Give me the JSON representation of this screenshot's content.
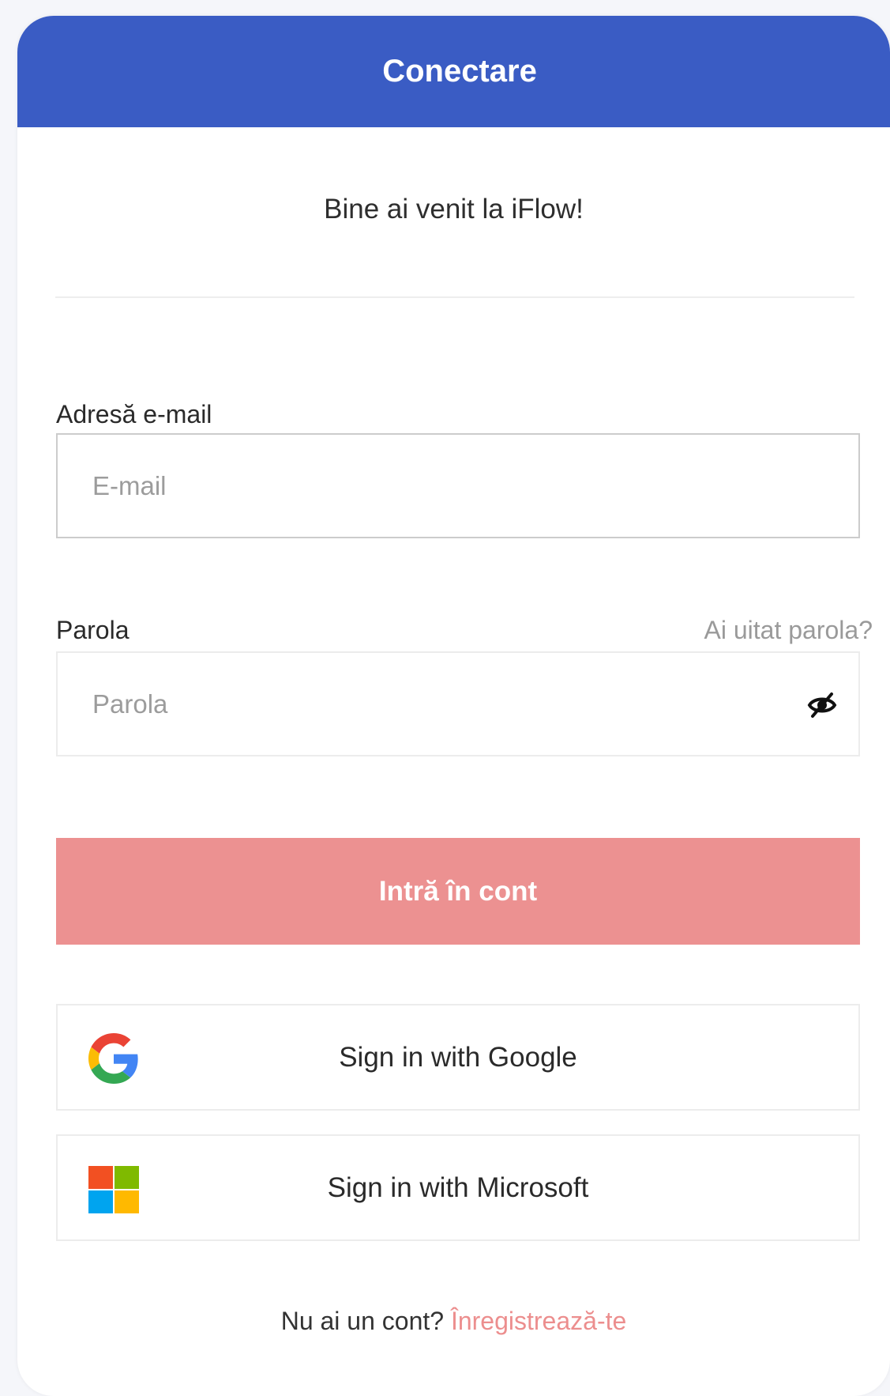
{
  "header": {
    "title": "Conectare"
  },
  "welcome": "Bine ai venit la iFlow!",
  "email": {
    "label": "Adresă e-mail",
    "placeholder": "E-mail",
    "value": ""
  },
  "password": {
    "label": "Parola",
    "placeholder": "Parola",
    "value": "",
    "forgot_link": "Ai uitat parola?",
    "toggle_icon": "eye-slash-icon"
  },
  "submit": {
    "label": "Intră în cont"
  },
  "sso": {
    "google": {
      "label": "Sign in with Google",
      "icon": "google-icon"
    },
    "microsoft": {
      "label": "Sign in with Microsoft",
      "icon": "microsoft-icon"
    }
  },
  "footer": {
    "prompt": "Nu ai un cont? ",
    "register_link": "Înregistrează-te"
  },
  "colors": {
    "header_bg": "#3a5cc4",
    "submit_bg": "#ec9191",
    "link_accent": "#ec8e8e"
  }
}
